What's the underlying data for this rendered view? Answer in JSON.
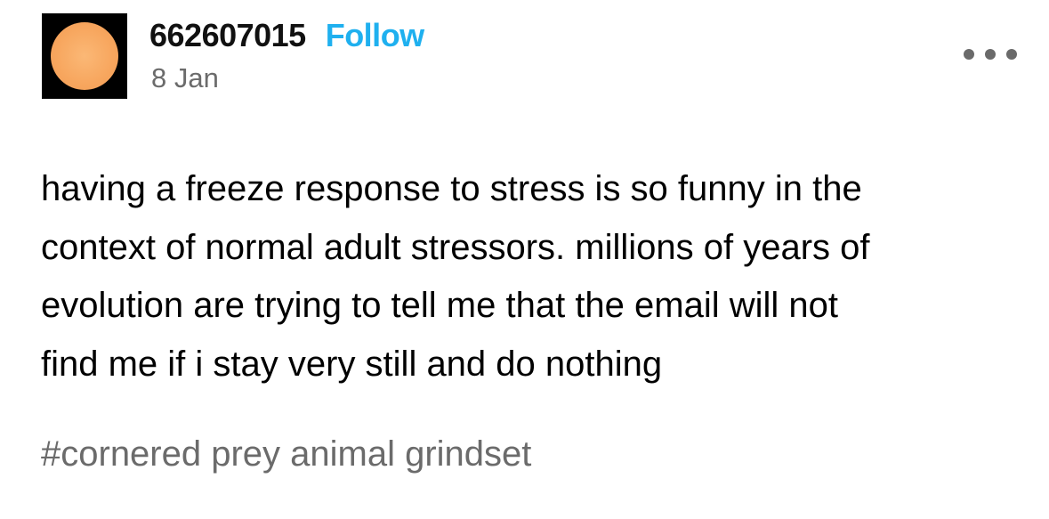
{
  "post": {
    "author": {
      "username": "662607015",
      "follow_label": "Follow",
      "avatar_icon": "sun-avatar-icon"
    },
    "date": "8 Jan",
    "more_icon": "more-options-icon",
    "body_lines": [
      "having a freeze response to stress is so funny in the",
      "context of normal adult stressors. millions of years of",
      "evolution are trying to tell me that the email will not",
      "find me if i stay very still and do nothing"
    ],
    "tags": [
      "#cornered prey animal grindset"
    ]
  },
  "colors": {
    "follow": "#1fb0ef",
    "meta_text": "#6b6b6b",
    "body_text": "#000000",
    "avatar_bg": "#000000",
    "avatar_sun": "#f7a65e"
  }
}
